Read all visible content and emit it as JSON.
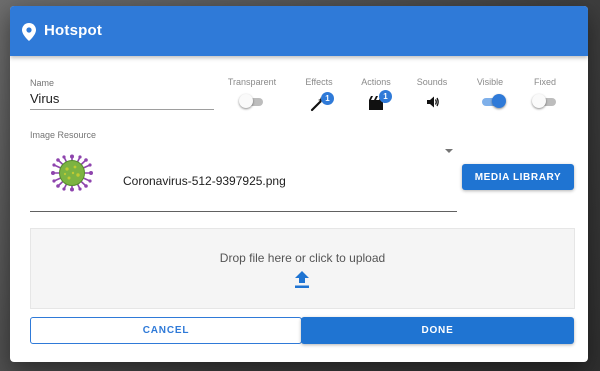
{
  "dialog": {
    "title": "Hotspot",
    "title_icon": "map-pin-icon"
  },
  "name": {
    "label": "Name",
    "value": "Virus"
  },
  "options": {
    "transparent": {
      "label": "Transparent",
      "state": "off"
    },
    "effects": {
      "label": "Effects",
      "icon": "magic-wand-icon",
      "badge": "1"
    },
    "actions": {
      "label": "Actions",
      "icon": "clapperboard-icon",
      "badge": "1"
    },
    "sounds": {
      "label": "Sounds",
      "icon": "speaker-icon"
    },
    "visible": {
      "label": "Visible",
      "state": "on"
    },
    "fixed": {
      "label": "Fixed",
      "state": "off"
    }
  },
  "image_resource": {
    "label": "Image Resource",
    "filename": "Coronavirus-512-9397925.png",
    "thumbnail_icon": "coronavirus-icon",
    "media_library_label": "MEDIA LIBRARY"
  },
  "dropzone": {
    "text": "Drop file here or click to upload",
    "icon": "upload-icon"
  },
  "buttons": {
    "cancel": "CANCEL",
    "done": "DONE"
  },
  "colors": {
    "primary": "#2f7ad8",
    "button": "#1f74d2",
    "virus_body": "#7cb342",
    "virus_spikes": "#8e44ad"
  }
}
